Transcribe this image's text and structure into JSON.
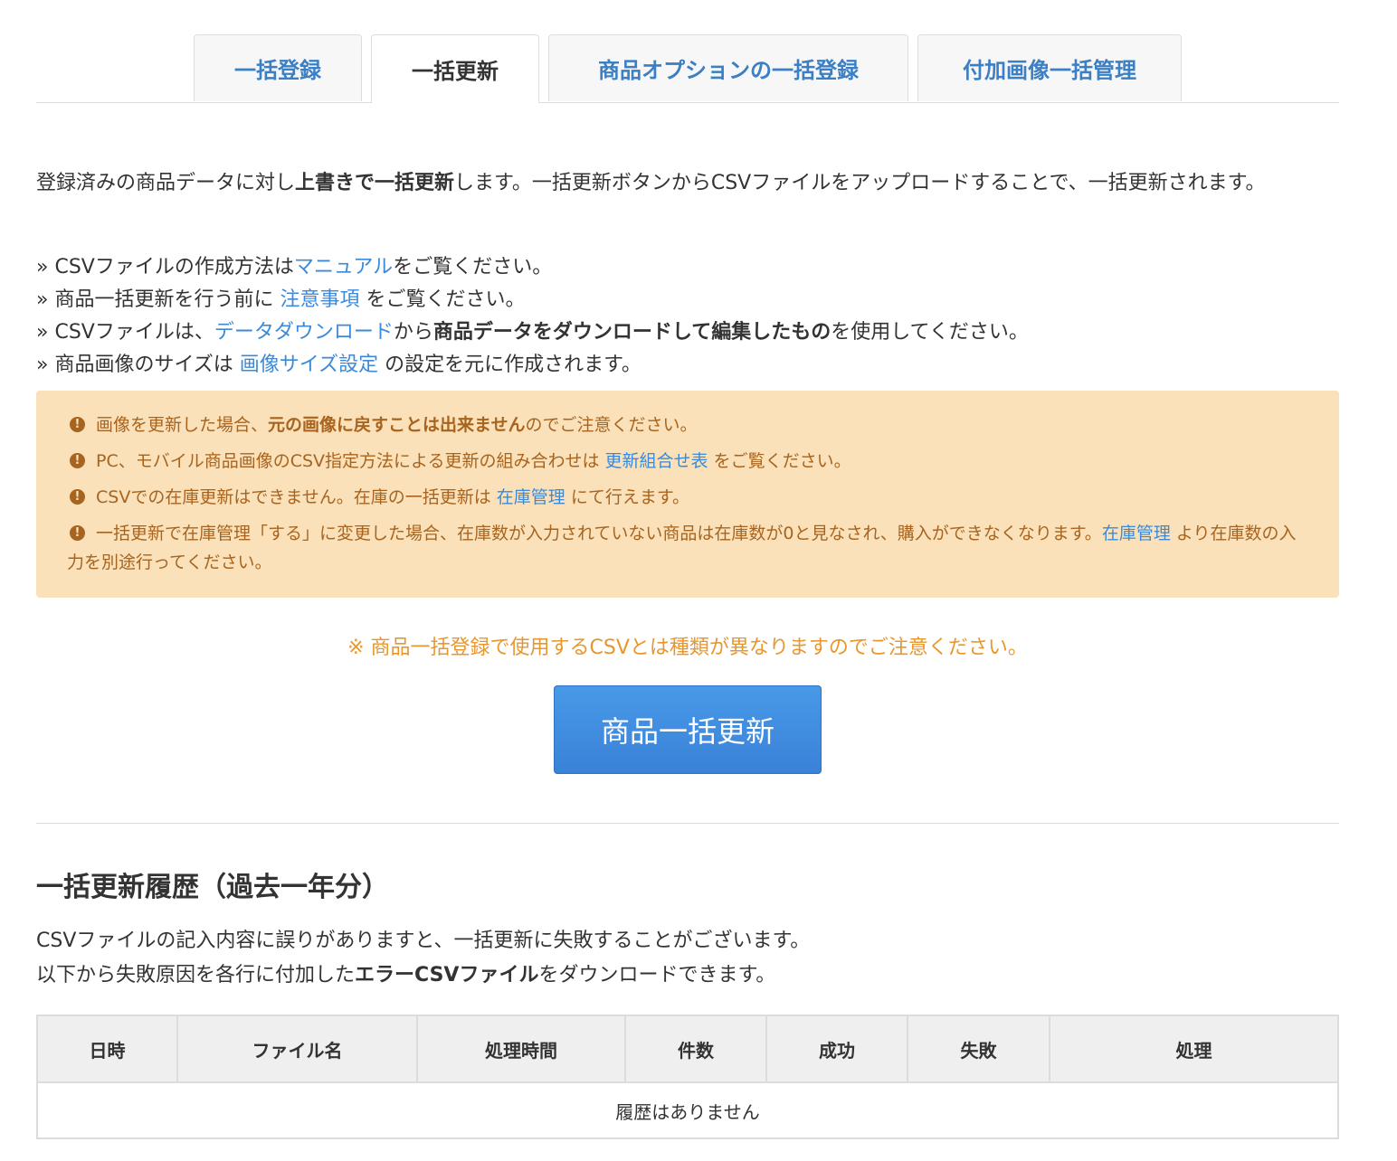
{
  "tabs": [
    {
      "label": "一括登録",
      "active": false
    },
    {
      "label": "一括更新",
      "active": true
    },
    {
      "label": "商品オプションの一括登録",
      "active": false
    },
    {
      "label": "付加画像一括管理",
      "active": false
    }
  ],
  "intro": {
    "part1": "登録済みの商品データに対し",
    "bold": "上書きで一括更新",
    "part2": "します。一括更新ボタンからCSVファイルをアップロードすることで、一括更新されます。"
  },
  "notes": {
    "n1_pre": "» CSVファイルの作成方法は",
    "n1_link": "マニュアル",
    "n1_post": "をご覧ください。",
    "n2_pre": "» 商品一括更新を行う前に ",
    "n2_link": "注意事項",
    "n2_post": " をご覧ください。",
    "n3_pre": "» CSVファイルは、",
    "n3_link": "データダウンロード",
    "n3_mid": "から",
    "n3_bold": "商品データをダウンロードして編集したもの",
    "n3_post": "を使用してください。",
    "n4_pre": "» 商品画像のサイズは ",
    "n4_link": "画像サイズ設定",
    "n4_post": " の設定を元に作成されます。"
  },
  "warnings": {
    "w1_pre": "画像を更新した場合、",
    "w1_bold": "元の画像に戻すことは出来ません",
    "w1_post": "のでご注意ください。",
    "w2_pre": "PC、モバイル商品画像のCSV指定方法による更新の組み合わせは ",
    "w2_link": "更新組合せ表",
    "w2_post": " をご覧ください。",
    "w3_pre": "CSVでの在庫更新はできません。在庫の一括更新は ",
    "w3_link": "在庫管理",
    "w3_post": " にて行えます。",
    "w4_pre": "一括更新で在庫管理「する」に変更した場合、在庫数が入力されていない商品は在庫数が0と見なされ、購入ができなくなります。",
    "w4_link": "在庫管理",
    "w4_post": " より在庫数の入力を別途行ってください。"
  },
  "caution": "※ 商品一括登録で使用するCSVとは種類が異なりますのでご注意ください。",
  "main_button": "商品一括更新",
  "history": {
    "title": "一括更新履歴（過去一年分）",
    "desc1": "CSVファイルの記入内容に誤りがありますと、一括更新に失敗することがございます。",
    "desc2_pre": "以下から失敗原因を各行に付加した",
    "desc2_bold": "エラーCSVファイル",
    "desc2_post": "をダウンロードできます。",
    "columns": [
      "日時",
      "ファイル名",
      "処理時間",
      "件数",
      "成功",
      "失敗",
      "処理"
    ],
    "empty": "履歴はありません"
  }
}
